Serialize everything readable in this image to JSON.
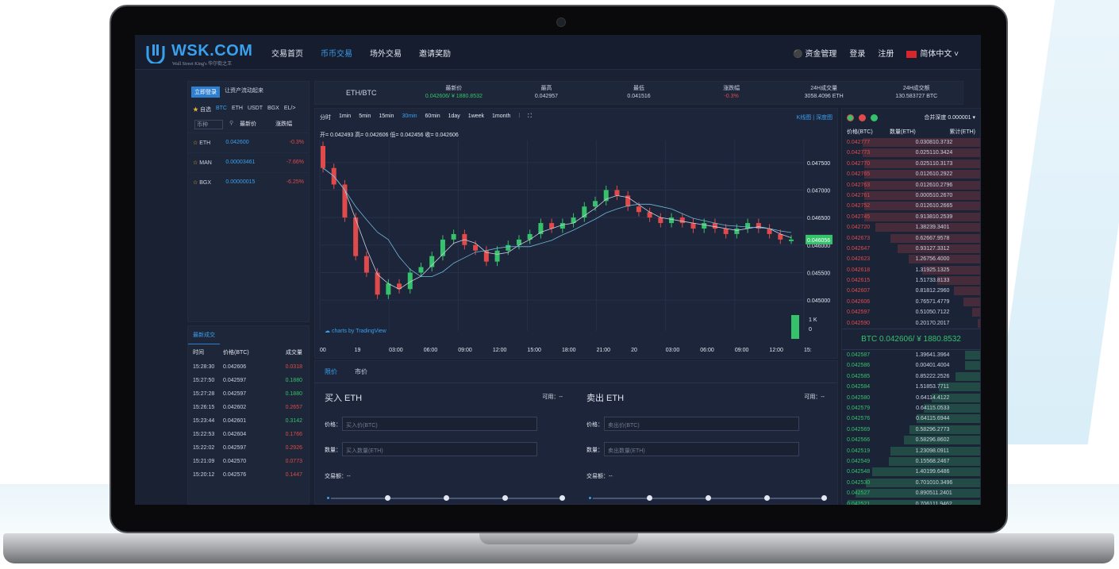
{
  "header": {
    "logo": "WSK.COM",
    "logo_sub": "Wall Street King's 华尔街之王",
    "nav": [
      "交易首页",
      "币币交易",
      "场外交易",
      "邀请奖励"
    ],
    "asset_mgmt": "资金管理",
    "login": "登录",
    "register": "注册",
    "language": "简体中文"
  },
  "market": {
    "login_btn": "立即登录",
    "login_hint": "让资产流动起来",
    "coin_tabs": [
      "自选",
      "BTC",
      "ETH",
      "USDT",
      "BGX",
      "EL/>"
    ],
    "search_placeholder": "币种",
    "col_price": "最新价",
    "col_change": "涨跌幅",
    "rows": [
      {
        "coin": "ETH",
        "price": "0.042600",
        "change": "-0.3%"
      },
      {
        "coin": "MAN",
        "price": "0.00003461",
        "change": "-7.66%"
      },
      {
        "coin": "BGX",
        "price": "0.00000015",
        "change": "-6.25%"
      }
    ]
  },
  "trades": {
    "title": "最新成交",
    "headers": [
      "时间",
      "价格(BTC)",
      "成交量"
    ],
    "rows": [
      {
        "time": "15:28:30",
        "price": "0.042606",
        "vol": "0.0318",
        "side": "red"
      },
      {
        "time": "15:27:50",
        "price": "0.042597",
        "vol": "0.1880",
        "side": "green"
      },
      {
        "time": "15:27:28",
        "price": "0.042597",
        "vol": "0.1880",
        "side": "green"
      },
      {
        "time": "15:26:15",
        "price": "0.042602",
        "vol": "0.2657",
        "side": "red"
      },
      {
        "time": "15:23:44",
        "price": "0.042601",
        "vol": "0.3142",
        "side": "green"
      },
      {
        "time": "15:22:53",
        "price": "0.042604",
        "vol": "0.1766",
        "side": "red"
      },
      {
        "time": "15:22:02",
        "price": "0.042597",
        "vol": "0.2926",
        "side": "red"
      },
      {
        "time": "15:21:09",
        "price": "0.042570",
        "vol": "0.0773",
        "side": "red"
      },
      {
        "time": "15:20:12",
        "price": "0.042576",
        "vol": "0.1447",
        "side": "red"
      }
    ]
  },
  "ticker": {
    "pair": "ETH/BTC",
    "items": [
      {
        "label": "最新价",
        "value": "0.042606/ ¥ 1880.8532",
        "color": "#35c26b"
      },
      {
        "label": "最高",
        "value": "0.042957",
        "color": "#c9d2e3"
      },
      {
        "label": "最低",
        "value": "0.041516",
        "color": "#c9d2e3"
      },
      {
        "label": "涨跌幅",
        "value": "-0.3%",
        "color": "#e04a4a"
      },
      {
        "label": "24H成交量",
        "value": "3058.4096 ETH",
        "color": "#c9d2e3"
      },
      {
        "label": "24H成交额",
        "value": "130.583727 BTC",
        "color": "#c9d2e3"
      }
    ]
  },
  "chart": {
    "timeframes": [
      "分时",
      "1min",
      "5min",
      "15min",
      "30min",
      "60min",
      "1day",
      "1week",
      "1month"
    ],
    "active_tf": "30min",
    "view_toggle": "K线图 | 深度图",
    "ohlc": "开= 0.042493 高= 0.042606 低= 0.042456 收= 0.042606",
    "credit": "charts by TradingView",
    "volume_ticks": [
      "1 K",
      "0"
    ],
    "x_ticks": [
      "00",
      "19",
      "03:00",
      "06:00",
      "09:00",
      "12:00",
      "15:00",
      "18:00",
      "21:00",
      "20",
      "03:00",
      "06:00",
      "09:00",
      "12:00",
      "15:"
    ]
  },
  "chart_data": {
    "type": "line",
    "title": "",
    "xlabel": "",
    "ylabel": "",
    "ylim": [
      0.0447,
      0.0479
    ],
    "y_ticks": [
      "0.047500",
      "0.047000",
      "0.046500",
      "0.046000",
      "0.045500",
      "0.045000"
    ],
    "last_price_label": "0.046056",
    "series": [
      {
        "values": [
          0.0474,
          0.0471,
          0.0465,
          0.0458,
          0.0455,
          0.0451,
          0.0453,
          0.0452,
          0.0455,
          0.0456,
          0.0458,
          0.0461,
          0.0462,
          0.046,
          0.0459,
          0.0457,
          0.0459,
          0.046,
          0.0461,
          0.0462,
          0.0464,
          0.0463,
          0.0464,
          0.0465,
          0.0467,
          0.0468,
          0.047,
          0.0469,
          0.0467,
          0.0466,
          0.0465,
          0.0464,
          0.0465,
          0.0464,
          0.0463,
          0.0464,
          0.0463,
          0.0462,
          0.0463,
          0.0464,
          0.0463,
          0.0462,
          0.0461,
          0.0461
        ]
      }
    ]
  },
  "order": {
    "tabs": [
      "限价",
      "市价"
    ],
    "buy_title": "买入 ETH",
    "sell_title": "卖出 ETH",
    "available": "可用：--",
    "price_label": "价格：",
    "qty_label": "数量：",
    "buy_price_ph": "买入价(BTC)",
    "buy_qty_ph": "买入数量(ETH)",
    "sell_price_ph": "卖出价(BTC)",
    "sell_qty_ph": "卖出数量(ETH)",
    "amount_label": "交易额：--"
  },
  "book": {
    "depth_select": "合并深度 0.000001",
    "headers": [
      "价格(BTC)",
      "数量(ETH)",
      "累计(ETH)"
    ],
    "asks": [
      [
        "0.042777",
        "0.0308",
        "10.3732",
        0.85
      ],
      [
        "0.042773",
        "0.0251",
        "10.3424",
        0.85
      ],
      [
        "0.042770",
        "0.0251",
        "10.3173",
        0.84
      ],
      [
        "0.042765",
        "0.0126",
        "10.2922",
        0.84
      ],
      [
        "0.042763",
        "0.0126",
        "10.2796",
        0.84
      ],
      [
        "0.042761",
        "0.0005",
        "10.2670",
        0.84
      ],
      [
        "0.042752",
        "0.0126",
        "10.2665",
        0.84
      ],
      [
        "0.042745",
        "0.9138",
        "10.2539",
        0.84
      ],
      [
        "0.042720",
        "1.3823",
        "9.3401",
        0.76
      ],
      [
        "0.042673",
        "0.6266",
        "7.9578",
        0.65
      ],
      [
        "0.042647",
        "0.9312",
        "7.3312",
        0.6
      ],
      [
        "0.042623",
        "1.2675",
        "6.4000",
        0.52
      ],
      [
        "0.042618",
        "1.3192",
        "5.1325",
        0.42
      ],
      [
        "0.042615",
        "1.5173",
        "3.8133",
        0.31
      ],
      [
        "0.042607",
        "0.8181",
        "2.2960",
        0.19
      ],
      [
        "0.042606",
        "0.7657",
        "1.4779",
        0.12
      ],
      [
        "0.042597",
        "0.5105",
        "0.7122",
        0.06
      ],
      [
        "0.042590",
        "0.2017",
        "0.2017",
        0.02
      ]
    ],
    "mid": "BTC 0.042606/ ¥ 1880.8532",
    "bids": [
      [
        "0.042587",
        "1.3964",
        "1.3964",
        0.11
      ],
      [
        "0.042586",
        "0.0040",
        "1.4004",
        0.11
      ],
      [
        "0.042585",
        "0.8522",
        "2.2526",
        0.18
      ],
      [
        "0.042584",
        "1.5185",
        "3.7711",
        0.3
      ],
      [
        "0.042580",
        "0.6411",
        "4.4122",
        0.35
      ],
      [
        "0.042579",
        "0.6411",
        "5.0533",
        0.41
      ],
      [
        "0.042576",
        "0.6411",
        "5.6944",
        0.46
      ],
      [
        "0.042569",
        "0.5829",
        "6.2773",
        0.51
      ],
      [
        "0.042566",
        "0.5829",
        "6.8602",
        0.55
      ],
      [
        "0.042519",
        "1.2309",
        "8.0911",
        0.65
      ],
      [
        "0.042549",
        "0.1556",
        "8.2467",
        0.66
      ],
      [
        "0.042548",
        "1.4019",
        "9.6486",
        0.78
      ],
      [
        "0.042530",
        "0.7010",
        "10.3496",
        0.83
      ],
      [
        "0.042527",
        "0.8905",
        "11.2401",
        0.9
      ],
      [
        "0.042521",
        "0.7061",
        "11.9462",
        0.96
      ]
    ]
  }
}
